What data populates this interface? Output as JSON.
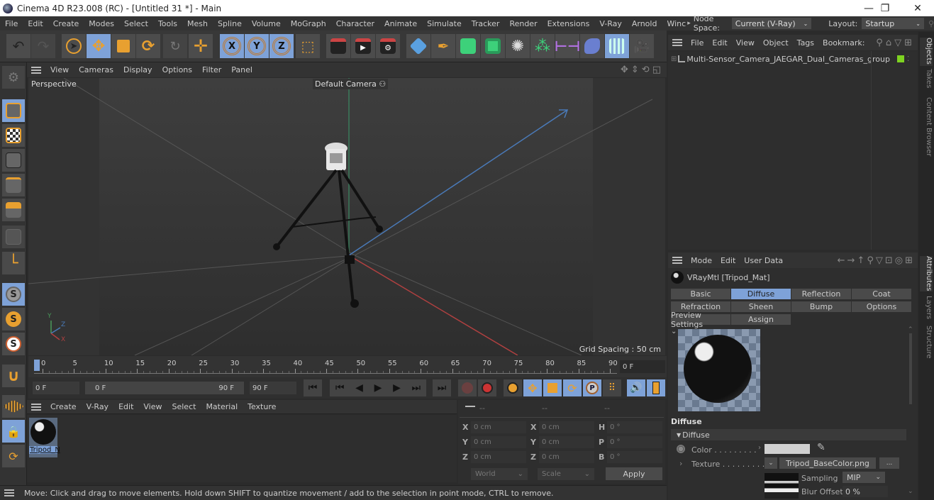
{
  "window": {
    "title": "Cinema 4D R23.008 (RC) - [Untitled 31 *] - Main",
    "controls": {
      "minimize": "—",
      "restore": "❐",
      "close": "✕"
    }
  },
  "menubar": {
    "items": [
      "File",
      "Edit",
      "Create",
      "Modes",
      "Select",
      "Tools",
      "Mesh",
      "Spline",
      "Volume",
      "MoGraph",
      "Character",
      "Animate",
      "Simulate",
      "Tracker",
      "Render",
      "Extensions",
      "V-Ray",
      "Arnold",
      "Winc"
    ],
    "overflow_arrow": "▸",
    "node_space_label": "Node Space:",
    "node_space_value": "Current (V-Ray)",
    "layout_label": "Layout:",
    "layout_value": "Startup"
  },
  "toolbar": {
    "axis_labels": [
      "X",
      "Y",
      "Z"
    ]
  },
  "viewport": {
    "menu": [
      "View",
      "Cameras",
      "Display",
      "Options",
      "Filter",
      "Panel"
    ],
    "view_name": "Perspective",
    "camera_label": "Default Camera",
    "grid_spacing": "Grid Spacing : 50 cm",
    "axis_letters": {
      "y": "Y",
      "z": "Z",
      "x": "X"
    }
  },
  "timeline": {
    "ticks": [
      "0",
      "5",
      "10",
      "15",
      "20",
      "25",
      "30",
      "35",
      "40",
      "45",
      "50",
      "55",
      "60",
      "65",
      "70",
      "75",
      "80",
      "85",
      "90"
    ],
    "current_frame": "0 F",
    "start_frame": "0 F",
    "range_start": "0 F",
    "range_end": "90 F",
    "end_frame": "90 F"
  },
  "material_manager": {
    "menu": [
      "Create",
      "V-Ray",
      "Edit",
      "View",
      "Select",
      "Material",
      "Texture"
    ],
    "materials": [
      {
        "name": "Tripod_N"
      }
    ]
  },
  "coordinates": {
    "headers": [
      "--",
      "--",
      "--"
    ],
    "rows": [
      {
        "l1": "X",
        "v1": "0 cm",
        "l2": "X",
        "v2": "0 cm",
        "l3": "H",
        "v3": "0 °"
      },
      {
        "l1": "Y",
        "v1": "0 cm",
        "l2": "Y",
        "v2": "0 cm",
        "l3": "P",
        "v3": "0 °"
      },
      {
        "l1": "Z",
        "v1": "0 cm",
        "l2": "Z",
        "v2": "0 cm",
        "l3": "B",
        "v3": "0 °"
      }
    ],
    "mode_select": "World",
    "type_select": "Scale",
    "apply_label": "Apply"
  },
  "status": {
    "text": "Move: Click and drag to move elements. Hold down SHIFT to quantize movement / add to the selection in point mode, CTRL to remove."
  },
  "objects_panel": {
    "menu": [
      "File",
      "Edit",
      "View",
      "Object",
      "Tags",
      "Bookmark:"
    ],
    "objects": [
      {
        "name": "Multi-Sensor_Camera_JAEGAR_Dual_Cameras_group",
        "color": "#7ed321"
      }
    ]
  },
  "attributes_panel": {
    "menu": [
      "Mode",
      "Edit",
      "User Data"
    ],
    "material_title": "VRayMtl [Tripod_Mat]",
    "tabs_row1": [
      "Basic",
      "Diffuse",
      "Reflection",
      "Coat"
    ],
    "tabs_row2": [
      "Refraction",
      "Sheen",
      "Bump",
      "Options"
    ],
    "tabs_row3": [
      "Preview Settings",
      "Assign"
    ],
    "active_tab": "Diffuse",
    "section_title": "Diffuse",
    "group_title": "Diffuse",
    "color_label": "Color . . . . . . . . .",
    "color_value": "#d0d0d0",
    "texture_label": "Texture . . . . . . . . .",
    "texture_file": "Tripod_BaseColor.png",
    "texture_more": "...",
    "sampling_label": "Sampling",
    "sampling_value": "MIP",
    "blur_label": "Blur Offset",
    "blur_value": "0 %"
  },
  "side_tabs": {
    "top": [
      "Objects",
      "Takes",
      "Content Browser"
    ],
    "bottom": [
      "Attributes",
      "Layers",
      "Structure"
    ]
  }
}
